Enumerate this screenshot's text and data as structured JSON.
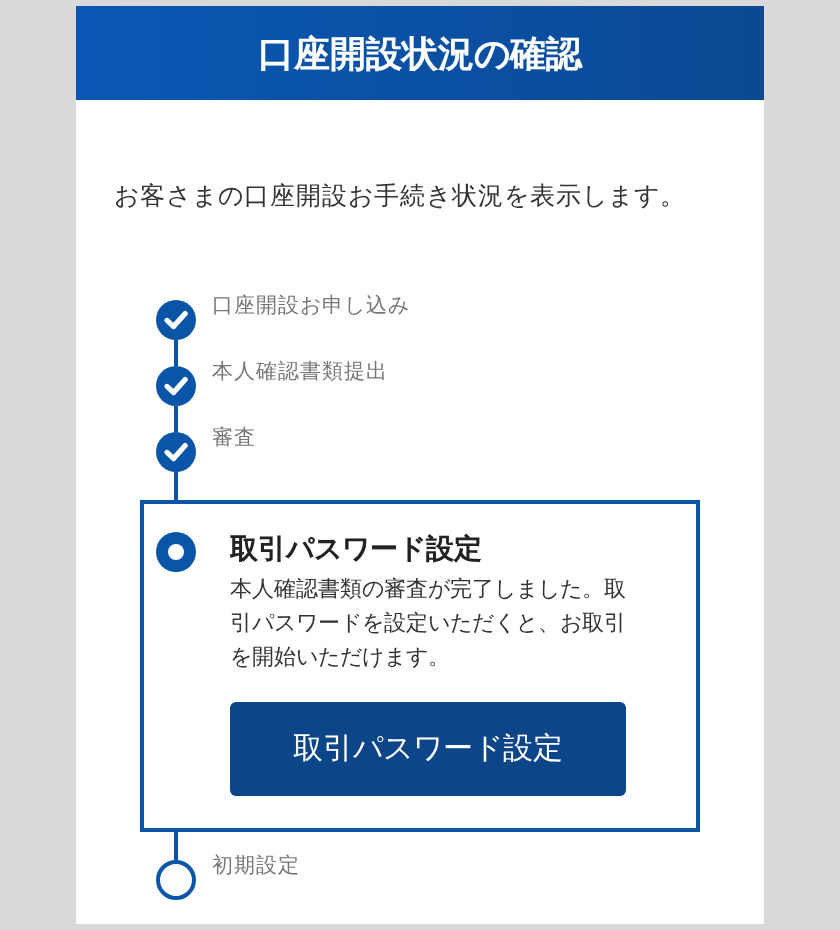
{
  "header": {
    "title": "口座開設状況の確認"
  },
  "intro": "お客さまの口座開設お手続き状況を表示します。",
  "steps": [
    {
      "kind": "done",
      "label": "口座開設お申し込み"
    },
    {
      "kind": "done",
      "label": "本人確認書類提出"
    },
    {
      "kind": "done",
      "label": "審査"
    },
    {
      "kind": "current",
      "label": "取引パスワード設定",
      "description": "本人確認書類の審査が完了しました。取引パスワードを設定いただくと、お取引を開始いただけます。",
      "button": "取引パスワード設定"
    },
    {
      "kind": "todo",
      "label": "初期設定"
    }
  ]
}
